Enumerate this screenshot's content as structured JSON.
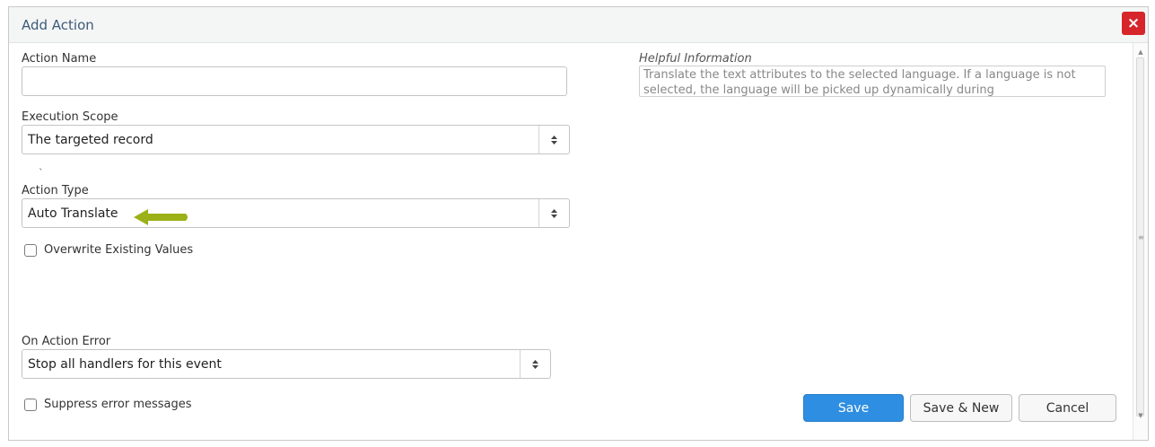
{
  "dialog": {
    "title": "Add Action",
    "close_label": "×"
  },
  "form": {
    "action_name": {
      "label": "Action Name",
      "value": ""
    },
    "execution_scope": {
      "label": "Execution Scope",
      "value": "The targeted record"
    },
    "stray_mark": "`",
    "action_type": {
      "label": "Action Type",
      "value": "Auto Translate"
    },
    "overwrite": {
      "label": "Overwrite Existing Values",
      "checked": false
    },
    "on_action_error": {
      "label": "On Action Error",
      "value": "Stop all handlers for this event"
    },
    "suppress": {
      "label": "Suppress error messages",
      "checked": false
    }
  },
  "help": {
    "label": "Helpful Information",
    "text": "Translate the text attributes to the selected language. If a language is not selected, the language will be picked up dynamically during"
  },
  "buttons": {
    "save": "Save",
    "save_new": "Save & New",
    "cancel": "Cancel"
  },
  "colors": {
    "accent": "#2e8ee1",
    "close": "#d7262b",
    "arrow": "#9cb017"
  },
  "icons": {
    "select_arrow": "updown-caret-icon",
    "pointer": "left-arrow-icon"
  }
}
